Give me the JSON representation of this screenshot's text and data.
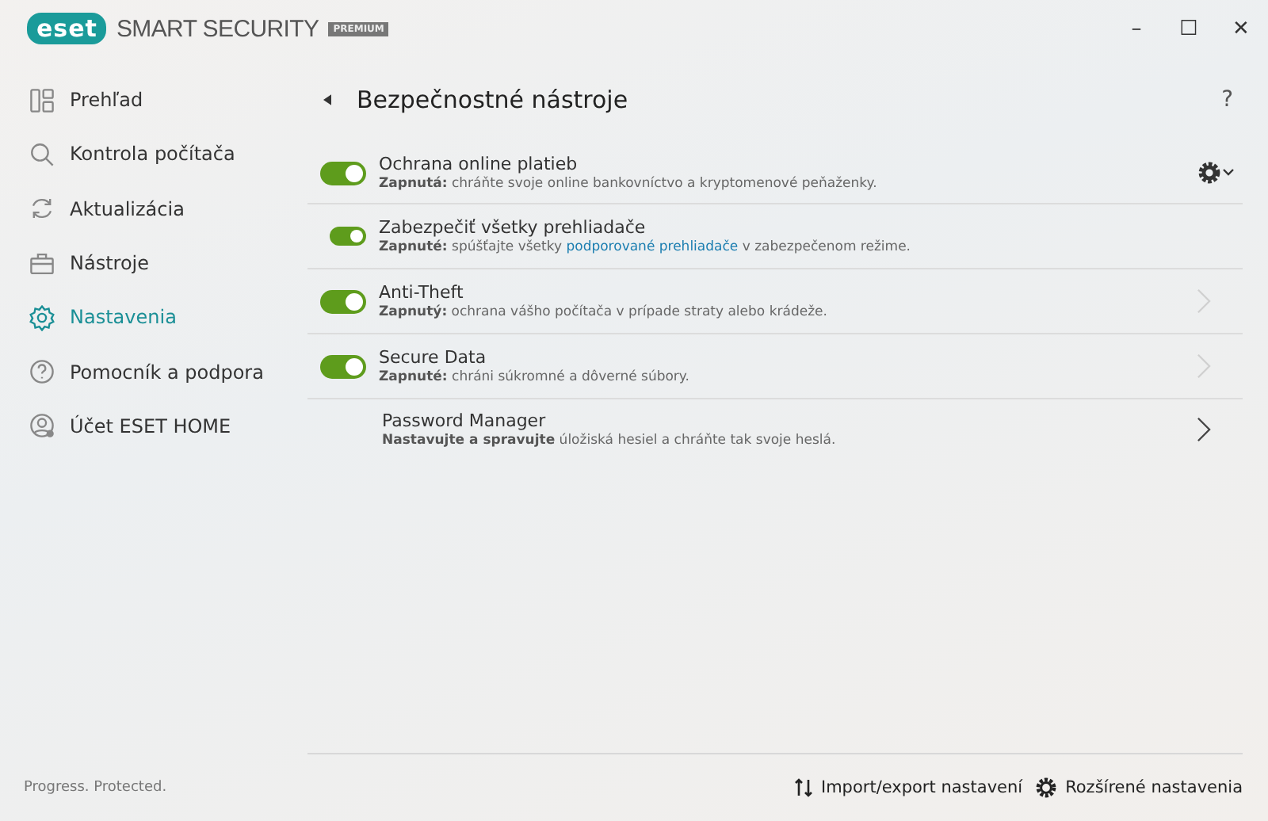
{
  "app": {
    "brand": "eset",
    "product": "SMART SECURITY",
    "edition": "PREMIUM"
  },
  "window_controls": [
    "–",
    "☐",
    "✕"
  ],
  "sidebar": {
    "items": [
      {
        "label": "Prehľad",
        "selected": false
      },
      {
        "label": "Kontrola počítača",
        "selected": false
      },
      {
        "label": "Aktualizácia",
        "selected": false
      },
      {
        "label": "Nástroje",
        "selected": false
      },
      {
        "label": "Nastavenia",
        "selected": true
      },
      {
        "label": "Pomocník a podpora",
        "selected": false
      },
      {
        "label": "Účet ESET HOME",
        "selected": false
      }
    ],
    "tagline": "Progress. Protected."
  },
  "page": {
    "title": "Bezpečnostné nástroje",
    "help": "?"
  },
  "features": [
    {
      "kind": "toggle-menu",
      "on": true,
      "title": "Ochrana online platieb",
      "description": [
        {
          "kind": "bold",
          "text": "Zapnutá:"
        },
        {
          "kind": "text",
          "text": " chráňte svoje online bankovníctvo a kryptomenové peňaženky."
        }
      ],
      "children": [
        {
          "kind": "toggle",
          "on": true,
          "title": "Zabezpečiť všetky prehliadače",
          "description": [
            {
              "kind": "bold",
              "text": "Zapnuté:"
            },
            {
              "kind": "text",
              "text": " spúšťajte všetky "
            },
            {
              "kind": "link",
              "text": "podporované prehliadače"
            },
            {
              "kind": "text",
              "text": " v zabezpečenom režime."
            }
          ]
        }
      ]
    },
    {
      "kind": "toggle-nav",
      "on": true,
      "disabled": true,
      "title": "Anti-Theft",
      "description": [
        {
          "kind": "bold",
          "text": "Zapnutý:"
        },
        {
          "kind": "text",
          "text": " ochrana vášho počítača v prípade straty alebo krádeže."
        }
      ]
    },
    {
      "kind": "toggle-nav",
      "on": true,
      "disabled": true,
      "title": "Secure Data",
      "description": [
        {
          "kind": "bold",
          "text": "Zapnuté:"
        },
        {
          "kind": "text",
          "text": " chráni súkromné a dôverné súbory."
        }
      ]
    },
    {
      "kind": "nav",
      "disabled": false,
      "title": "Password Manager",
      "description": [
        {
          "kind": "bold",
          "text": "Nastavujte a spravujte"
        },
        {
          "kind": "text",
          "text": " úložiská hesiel a chráňte tak svoje heslá."
        }
      ]
    }
  ],
  "footer": {
    "actions": [
      {
        "label": "Import/export nastavení"
      },
      {
        "label": "Rozšírené nastavenia"
      }
    ]
  }
}
